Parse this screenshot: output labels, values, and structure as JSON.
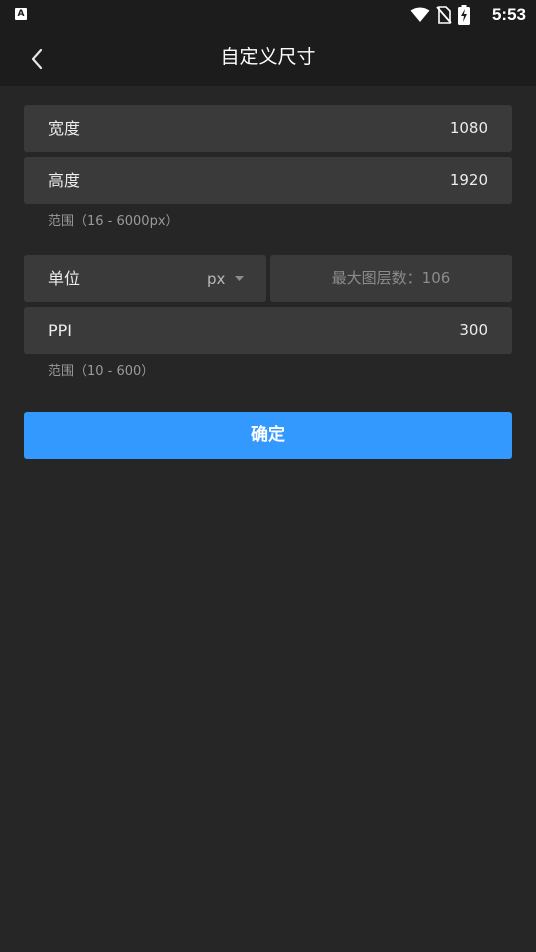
{
  "status_bar": {
    "time": "5:53",
    "app_icon_letter": "A",
    "icons": [
      "wifi-icon",
      "no-sim-icon",
      "battery-charging-icon"
    ]
  },
  "header": {
    "title": "自定义尺寸",
    "back_icon": "chevron-left-icon"
  },
  "form": {
    "width": {
      "label": "宽度",
      "value": "1080"
    },
    "height": {
      "label": "高度",
      "value": "1920"
    },
    "size_hint": "范围（16 - 6000px）",
    "unit": {
      "label": "单位",
      "value": "px",
      "icon": "dropdown-arrow-icon"
    },
    "max_layers": "最大图层数：106",
    "ppi": {
      "label": "PPI",
      "value": "300"
    },
    "ppi_hint": "范围（10 - 600）"
  },
  "confirm_label": "确定",
  "colors": {
    "background": "#262626",
    "bar": "#1c1c1c",
    "field": "#3a3a3a",
    "accent": "#3399ff"
  }
}
